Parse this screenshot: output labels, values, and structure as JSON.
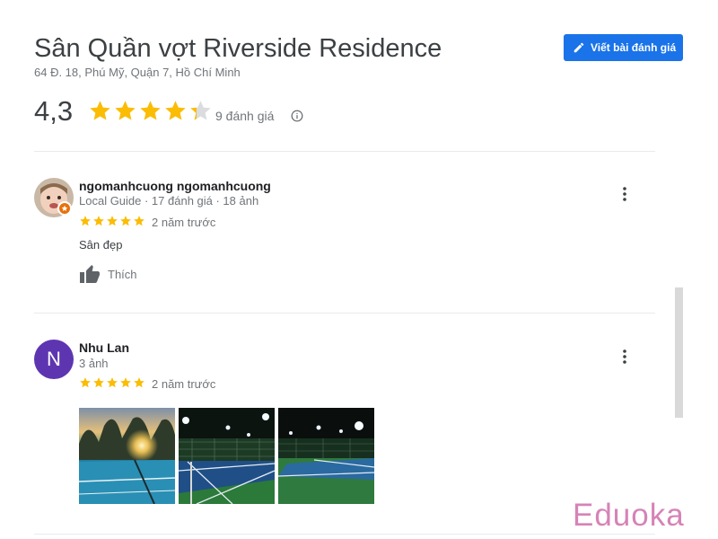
{
  "place": {
    "title": "Sân Quần vợt Riverside Residence",
    "address": "64 Đ. 18, Phú Mỹ, Quận 7, Hồ Chí Minh"
  },
  "write_review": {
    "label": "Viết bài đánh giá",
    "icon": "pencil-icon"
  },
  "summary": {
    "rating_text": "4,3",
    "rating_value": 4.3,
    "reviews_count": "9 đánh giá",
    "info_icon": "info-icon"
  },
  "reviews": [
    {
      "name": "ngomanhcuong ngomanhcuong",
      "meta": "Local Guide · 17 đánh giá · 18 ảnh",
      "rating": 5,
      "time": "2 năm trước",
      "text": "Sân đẹp",
      "like_label": "Thích"
    },
    {
      "name": "Nhu Lan",
      "avatar_letter": "N",
      "meta": "3 ảnh",
      "rating": 5,
      "time": "2 năm trước"
    }
  ],
  "watermark": "Eduoka",
  "colors": {
    "star": "#fbbc04",
    "star_empty": "#dadce0",
    "button": "#1a73e8",
    "avatar_purple": "#5e35b1",
    "badge_orange": "#e8710a",
    "watermark": "#d683b6"
  }
}
